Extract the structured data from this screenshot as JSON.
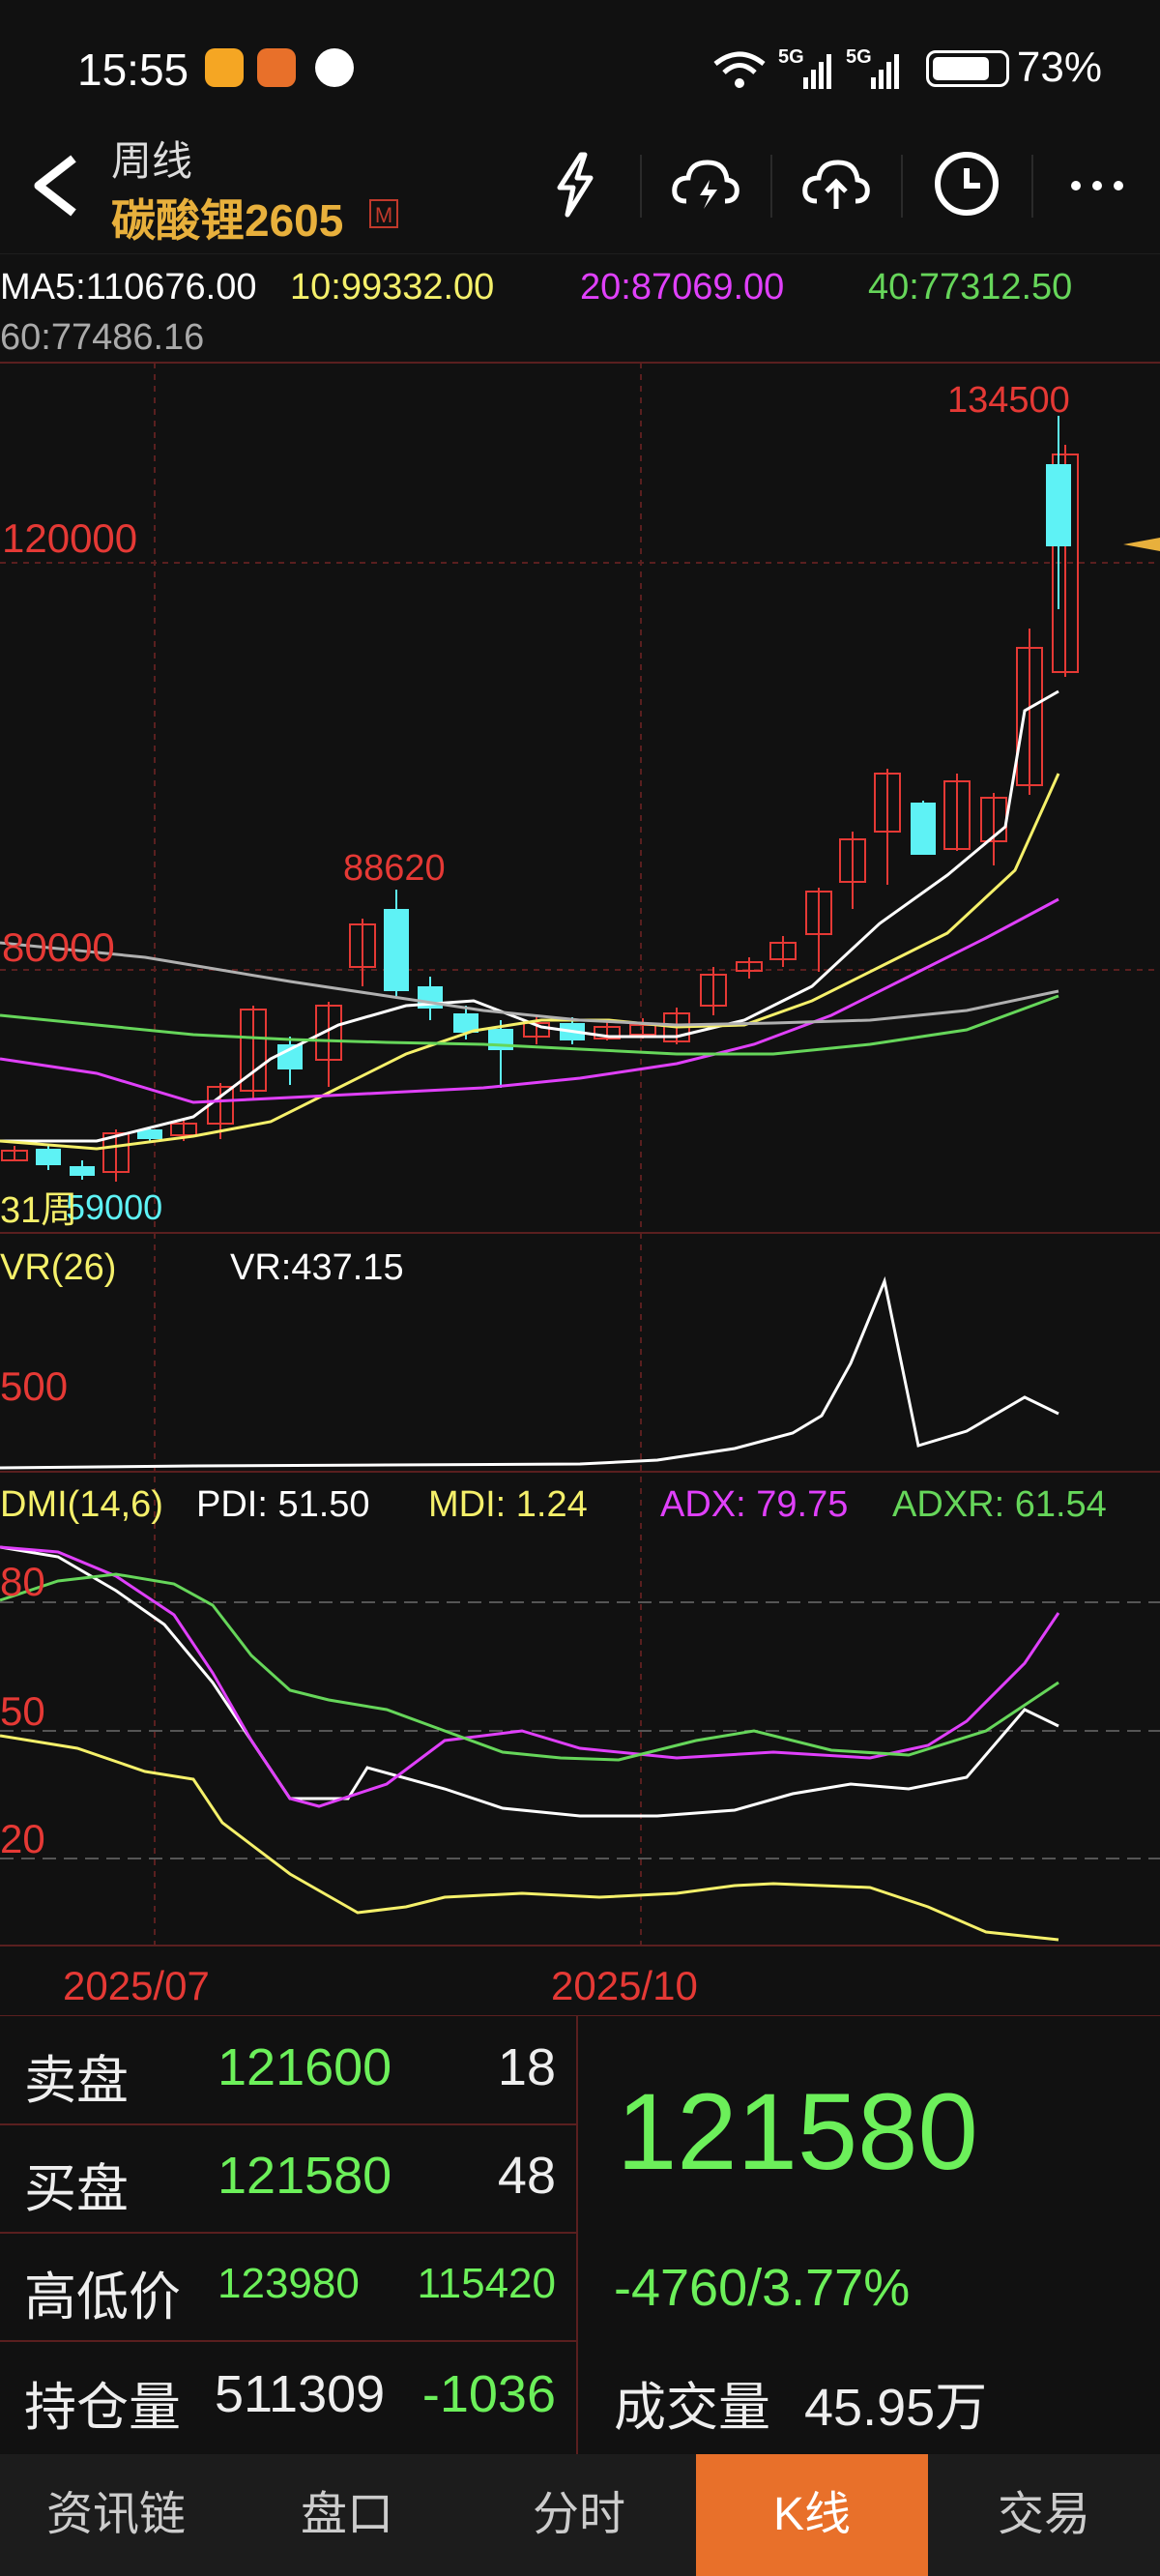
{
  "status_bar": {
    "time": "15:55",
    "battery": "73%",
    "net1": "5G",
    "net2": "5G"
  },
  "header": {
    "subtitle": "周线",
    "title": "碳酸锂2605",
    "badge": "M",
    "icons": [
      "lightning-icon",
      "cloud-download-icon",
      "cloud-upload-icon",
      "clock-icon",
      "more-icon"
    ]
  },
  "ma_line": {
    "ma5": "MA5:110676.00",
    "ma10": "10:99332.00",
    "ma20": "20:87069.00",
    "ma40": "40:77312.50",
    "ma60": "60:77486.16"
  },
  "colors": {
    "up": "#e53935",
    "down": "#5ef2f5",
    "ma5": "#ffffff",
    "ma10": "#f5f06a",
    "ma20": "#e040fb",
    "ma40": "#66d65a",
    "ma60": "#b0b0b0",
    "accent": "#e8702a",
    "green_text": "#6cf05a"
  },
  "price_chart": {
    "level_high": "120000",
    "level_low": "80000",
    "max_label": "134500",
    "peak_label": "88620",
    "min_label": "59000",
    "period_label": "31周"
  },
  "vr": {
    "title": "VR(26)",
    "value": "VR:437.15",
    "level": "500"
  },
  "dmi": {
    "title": "DMI(14,6)",
    "pdi": "PDI: 51.50",
    "mdi": "MDI: 1.24",
    "adx": "ADX: 79.75",
    "adxr": "ADXR: 61.54",
    "levels": [
      "80",
      "50",
      "20"
    ]
  },
  "dates": [
    "2025/07",
    "2025/10"
  ],
  "quote": {
    "sell_label": "卖盘",
    "sell_price": "121600",
    "sell_qty": "18",
    "buy_label": "买盘",
    "buy_price": "121580",
    "buy_qty": "48",
    "hl_label": "高低价",
    "high": "123980",
    "low": "115420",
    "oi_label": "持仓量",
    "oi": "511309",
    "oi_change": "-1036",
    "last": "121580",
    "change": "-4760/3.77%",
    "vol_label": "成交量",
    "volume": "45.95万"
  },
  "nav": [
    "资讯链",
    "盘口",
    "分时",
    "K线",
    "交易"
  ],
  "nav_active": 3
}
